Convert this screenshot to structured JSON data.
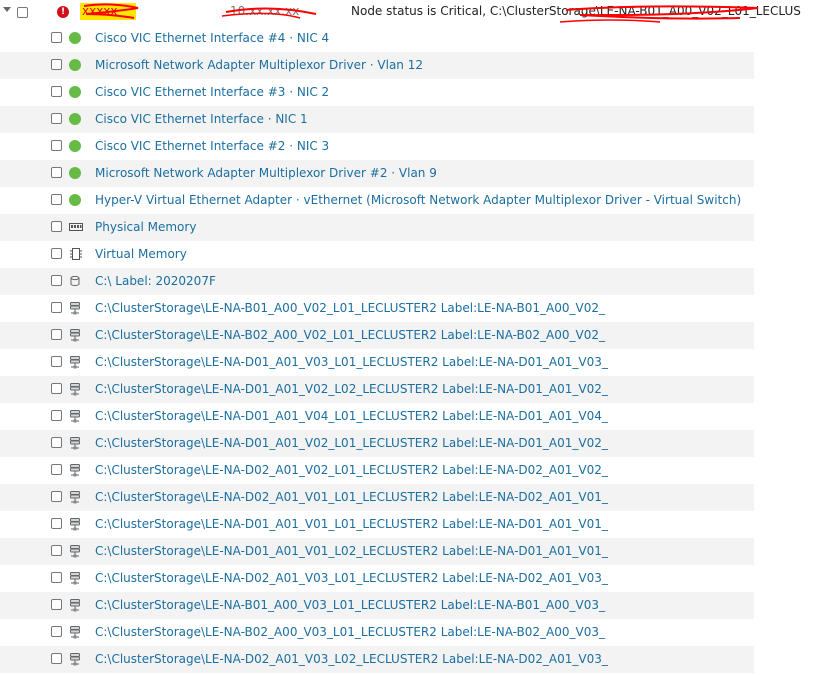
{
  "header": {
    "status_text": "Node status is Critical, C:\\ClusterStorage\\LE-NA-B01_A00_V02_L01_LECLUS",
    "redacted_name": "xxxxx",
    "redacted_ip": "10.xx.xx.xx",
    "critical_icon": "exclamation-icon"
  },
  "rows": [
    {
      "label": "Cisco VIC Ethernet Interface #4 · NIC 4",
      "icon": "status-up-icon"
    },
    {
      "label": "Microsoft Network Adapter Multiplexor Driver · Vlan 12",
      "icon": "status-up-icon"
    },
    {
      "label": "Cisco VIC Ethernet Interface #3 · NIC 2",
      "icon": "status-up-icon"
    },
    {
      "label": "Cisco VIC Ethernet Interface · NIC 1",
      "icon": "status-up-icon"
    },
    {
      "label": "Cisco VIC Ethernet Interface #2 · NIC 3",
      "icon": "status-up-icon"
    },
    {
      "label": "Microsoft Network Adapter Multiplexor Driver #2 · Vlan 9",
      "icon": "status-up-icon"
    },
    {
      "label": "Hyper-V Virtual Ethernet Adapter · vEthernet (Microsoft Network Adapter Multiplexor Driver - Virtual Switch)",
      "icon": "status-up-icon"
    },
    {
      "label": "Physical Memory",
      "icon": "memory-icon"
    },
    {
      "label": "Virtual Memory",
      "icon": "virtual-memory-icon"
    },
    {
      "label": "C:\\ Label: 2020207F",
      "icon": "disk-icon"
    },
    {
      "label": "C:\\ClusterStorage\\LE-NA-B01_A00_V02_L01_LECLUSTER2 Label:LE-NA-B01_A00_V02_",
      "icon": "network-volume-icon"
    },
    {
      "label": "C:\\ClusterStorage\\LE-NA-B02_A00_V02_L01_LECLUSTER2 Label:LE-NA-B02_A00_V02_",
      "icon": "network-volume-icon"
    },
    {
      "label": "C:\\ClusterStorage\\LE-NA-D01_A01_V03_L01_LECLUSTER2 Label:LE-NA-D01_A01_V03_",
      "icon": "network-volume-icon"
    },
    {
      "label": "C:\\ClusterStorage\\LE-NA-D01_A01_V02_L02_LECLUSTER2 Label:LE-NA-D01_A01_V02_",
      "icon": "network-volume-icon"
    },
    {
      "label": "C:\\ClusterStorage\\LE-NA-D01_A01_V04_L01_LECLUSTER2 Label:LE-NA-D01_A01_V04_",
      "icon": "network-volume-icon"
    },
    {
      "label": "C:\\ClusterStorage\\LE-NA-D01_A01_V02_L01_LECLUSTER2 Label:LE-NA-D01_A01_V02_",
      "icon": "network-volume-icon"
    },
    {
      "label": "C:\\ClusterStorage\\LE-NA-D02_A01_V02_L01_LECLUSTER2 Label:LE-NA-D02_A01_V02_",
      "icon": "network-volume-icon"
    },
    {
      "label": "C:\\ClusterStorage\\LE-NA-D02_A01_V01_L01_LECLUSTER2 Label:LE-NA-D02_A01_V01_",
      "icon": "network-volume-icon"
    },
    {
      "label": "C:\\ClusterStorage\\LE-NA-D01_A01_V01_L01_LECLUSTER2 Label:LE-NA-D01_A01_V01_",
      "icon": "network-volume-icon"
    },
    {
      "label": "C:\\ClusterStorage\\LE-NA-D01_A01_V01_L02_LECLUSTER2 Label:LE-NA-D01_A01_V01_",
      "icon": "network-volume-icon"
    },
    {
      "label": "C:\\ClusterStorage\\LE-NA-D02_A01_V03_L01_LECLUSTER2 Label:LE-NA-D02_A01_V03_",
      "icon": "network-volume-icon"
    },
    {
      "label": "C:\\ClusterStorage\\LE-NA-B01_A00_V03_L01_LECLUSTER2 Label:LE-NA-B01_A00_V03_",
      "icon": "network-volume-icon"
    },
    {
      "label": "C:\\ClusterStorage\\LE-NA-B02_A00_V03_L01_LECLUSTER2 Label:LE-NA-B02_A00_V03_",
      "icon": "network-volume-icon"
    },
    {
      "label": "C:\\ClusterStorage\\LE-NA-D02_A01_V03_L02_LECLUSTER2 Label:LE-NA-D02_A01_V03_",
      "icon": "network-volume-icon"
    }
  ],
  "colors": {
    "link": "#1b6ea0",
    "status_up": "#66bb47",
    "critical": "#d0111b",
    "row_alt": "#f3f3f3",
    "redaction": "#ff0000"
  }
}
